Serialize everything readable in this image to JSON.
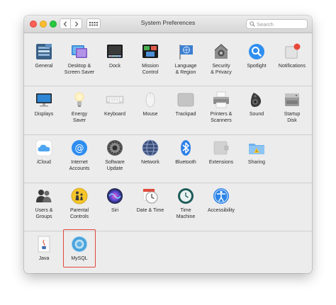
{
  "window": {
    "title": "System Preferences",
    "search_placeholder": "Search"
  },
  "colors": {
    "selection_border": "#e0483e",
    "window_background": "#ececec"
  },
  "rows": [
    [
      {
        "id": "general",
        "label": "General",
        "icon": "general-icon"
      },
      {
        "id": "desktop",
        "label": "Desktop &\nScreen Saver",
        "icon": "desktop-screen-saver-icon"
      },
      {
        "id": "dock",
        "label": "Dock",
        "icon": "dock-icon"
      },
      {
        "id": "mission",
        "label": "Mission\nControl",
        "icon": "mission-control-icon"
      },
      {
        "id": "language",
        "label": "Language\n& Region",
        "icon": "language-region-icon"
      },
      {
        "id": "security",
        "label": "Security\n& Privacy",
        "icon": "security-privacy-icon"
      },
      {
        "id": "spotlight",
        "label": "Spotlight",
        "icon": "spotlight-icon"
      },
      {
        "id": "notifications",
        "label": "Notifications",
        "icon": "notifications-icon"
      }
    ],
    [
      {
        "id": "displays",
        "label": "Displays",
        "icon": "displays-icon"
      },
      {
        "id": "energy",
        "label": "Energy\nSaver",
        "icon": "energy-saver-icon"
      },
      {
        "id": "keyboard",
        "label": "Keyboard",
        "icon": "keyboard-icon"
      },
      {
        "id": "mouse",
        "label": "Mouse",
        "icon": "mouse-icon"
      },
      {
        "id": "trackpad",
        "label": "Trackpad",
        "icon": "trackpad-icon"
      },
      {
        "id": "printers",
        "label": "Printers &\nScanners",
        "icon": "printers-scanners-icon"
      },
      {
        "id": "sound",
        "label": "Sound",
        "icon": "sound-icon"
      },
      {
        "id": "startup",
        "label": "Startup\nDisk",
        "icon": "startup-disk-icon"
      }
    ],
    [
      {
        "id": "icloud",
        "label": "iCloud",
        "icon": "icloud-icon"
      },
      {
        "id": "internet",
        "label": "Internet\nAccounts",
        "icon": "internet-accounts-icon"
      },
      {
        "id": "software",
        "label": "Software\nUpdate",
        "icon": "software-update-icon"
      },
      {
        "id": "network",
        "label": "Network",
        "icon": "network-icon"
      },
      {
        "id": "bluetooth",
        "label": "Bluetooth",
        "icon": "bluetooth-icon"
      },
      {
        "id": "extensions",
        "label": "Extensions",
        "icon": "extensions-icon"
      },
      {
        "id": "sharing",
        "label": "Sharing",
        "icon": "sharing-icon"
      }
    ],
    [
      {
        "id": "users",
        "label": "Users &\nGroups",
        "icon": "users-groups-icon"
      },
      {
        "id": "parental",
        "label": "Parental\nControls",
        "icon": "parental-controls-icon"
      },
      {
        "id": "siri",
        "label": "Siri",
        "icon": "siri-icon"
      },
      {
        "id": "datetime",
        "label": "Date & Time",
        "icon": "date-time-icon"
      },
      {
        "id": "timemachine",
        "label": "Time\nMachine",
        "icon": "time-machine-icon"
      },
      {
        "id": "accessibility",
        "label": "Accessibility",
        "icon": "accessibility-icon"
      }
    ],
    [
      {
        "id": "java",
        "label": "Java",
        "icon": "java-icon"
      },
      {
        "id": "mysql",
        "label": "MySQL",
        "icon": "mysql-icon",
        "selected": true
      }
    ]
  ]
}
